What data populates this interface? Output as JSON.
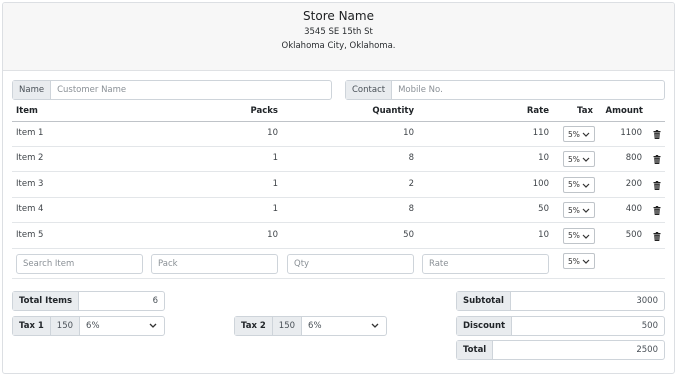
{
  "store": {
    "name": "Store Name",
    "address_line1": "3545 SE 15th St",
    "address_line2": "Oklahoma City, Oklahoma."
  },
  "customer": {
    "name_label": "Name",
    "name_placeholder": "Customer Name",
    "contact_label": "Contact",
    "contact_placeholder": "Mobile No."
  },
  "table": {
    "headers": {
      "item": "Item",
      "packs": "Packs",
      "quantity": "Quantity",
      "rate": "Rate",
      "tax": "Tax",
      "amount": "Amount"
    },
    "rows": [
      {
        "item": "Item 1",
        "packs": "10",
        "quantity": "10",
        "rate": "110",
        "tax": "5%",
        "amount": "1100"
      },
      {
        "item": "Item 2",
        "packs": "1",
        "quantity": "8",
        "rate": "10",
        "tax": "5%",
        "amount": "800"
      },
      {
        "item": "Item 3",
        "packs": "1",
        "quantity": "2",
        "rate": "100",
        "tax": "5%",
        "amount": "200"
      },
      {
        "item": "Item 4",
        "packs": "1",
        "quantity": "8",
        "rate": "50",
        "tax": "5%",
        "amount": "400"
      },
      {
        "item": "Item 5",
        "packs": "10",
        "quantity": "50",
        "rate": "10",
        "tax": "5%",
        "amount": "500"
      }
    ]
  },
  "entry": {
    "item_placeholder": "Search Item",
    "pack_placeholder": "Pack",
    "qty_placeholder": "Qty",
    "rate_placeholder": "Rate",
    "tax_value": "5%"
  },
  "summary": {
    "total_items_label": "Total Items",
    "total_items_value": "6",
    "tax1_label": "Tax 1",
    "tax1_amount": "150",
    "tax1_rate": "6%",
    "tax2_label": "Tax 2",
    "tax2_amount": "150",
    "tax2_rate": "6%",
    "subtotal_label": "Subtotal",
    "subtotal_value": "3000",
    "discount_label": "Discount",
    "discount_value": "500",
    "total_label": "Total",
    "total_value": "2500"
  }
}
